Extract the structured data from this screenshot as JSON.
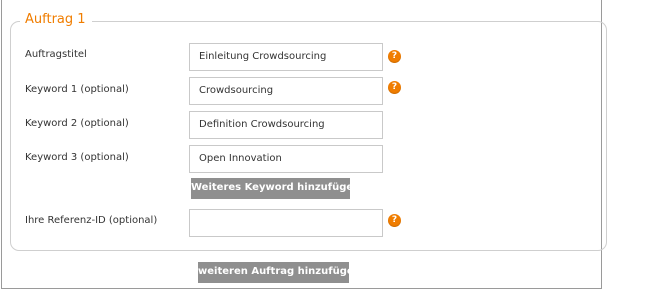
{
  "section": {
    "legend": "Auftrag 1"
  },
  "fields": [
    {
      "label": "Auftragstitel",
      "value": "Einleitung Crowdsourcing",
      "has_help": true
    },
    {
      "label": "Keyword 1 (optional)",
      "value": "Crowdsourcing",
      "has_help": true
    },
    {
      "label": "Keyword 2 (optional)",
      "value": "Definition Crowdsourcing",
      "has_help": false
    },
    {
      "label": "Keyword 3 (optional)",
      "value": "Open Innovation",
      "has_help": false
    }
  ],
  "add_keyword_button": "Weiteres Keyword hinzufügen",
  "reference": {
    "label": "Ihre Referenz-ID (optional)",
    "value": "",
    "has_help": true
  },
  "add_order_button": "weiteren Auftrag hinzufügen",
  "help_glyph": "?",
  "help_icon_name": "question-mark-icon",
  "colors": {
    "accent": "#f07d00",
    "button": "#8f8f8f"
  }
}
